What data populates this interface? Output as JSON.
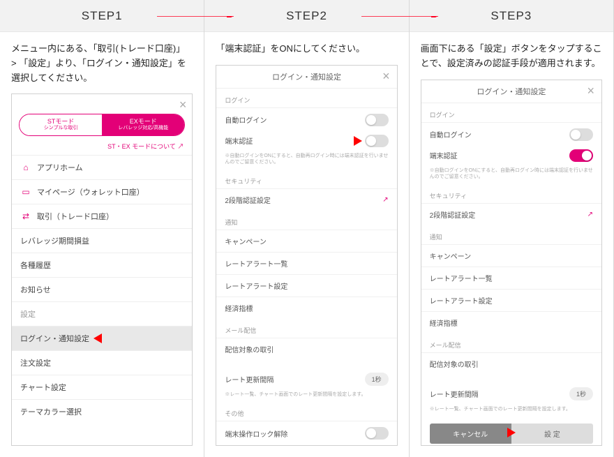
{
  "steps": {
    "s1": "STEP1",
    "s2": "STEP2",
    "s3": "STEP3"
  },
  "instructions": {
    "s1": "メニュー内にある、「取引(トレード口座)」 > 「設定」より、「ログイン・通知設定」を選択してください。",
    "s2": "「端末認証」をONにしてください。",
    "s3": "画面下にある「設定」ボタンをタップすることで、設定済みの認証手段が適用されます。"
  },
  "step1": {
    "mode_st_title": "STモード",
    "mode_st_sub": "シンプルな取引",
    "mode_ex_title": "EXモード",
    "mode_ex_sub": "レバレッジ対応/高機能",
    "mode_link": "ST・EX モードについて ↗",
    "menu": [
      {
        "icon": "home",
        "label": "アプリホーム"
      },
      {
        "icon": "card",
        "label": "マイページ（ウォレット口座）"
      },
      {
        "icon": "swap",
        "label": "取引（トレード口座）"
      },
      {
        "icon": "",
        "label": "レバレッジ期間損益"
      },
      {
        "icon": "",
        "label": "各種履歴"
      },
      {
        "icon": "",
        "label": "お知らせ"
      },
      {
        "icon": "",
        "label": "設定",
        "dim": true
      },
      {
        "icon": "",
        "label": "ログイン・通知設定",
        "hl": true,
        "pointer": true
      },
      {
        "icon": "",
        "label": "注文設定"
      },
      {
        "icon": "",
        "label": "チャート設定"
      },
      {
        "icon": "",
        "label": "テーマカラー選択"
      }
    ]
  },
  "settings": {
    "title": "ログイン・通知設定",
    "sec_login": "ログイン",
    "row_auto": "自動ログイン",
    "row_device": "端末認証",
    "device_note": "※自動ログインをONにすると、自動再ログイン時には端末認証を行いませんのでご留意ください。",
    "sec_security": "セキュリティ",
    "row_2fa": "2段階認証設定",
    "sec_notify": "通知",
    "notify_rows": [
      "キャンペーン",
      "レートアラート一覧",
      "レートアラート設定",
      "経済指標"
    ],
    "sec_mail": "メール配信",
    "row_mail": "配信対象の取引",
    "row_interval": "レート更新間隔",
    "interval_val": "1秒",
    "interval_note": "※レート一覧、チャート画面でのレート更新間隔を設定します。",
    "sec_other": "その他",
    "row_lock": "端末操作ロック解除",
    "btn_cancel": "キャンセル",
    "btn_set": "設 定"
  }
}
